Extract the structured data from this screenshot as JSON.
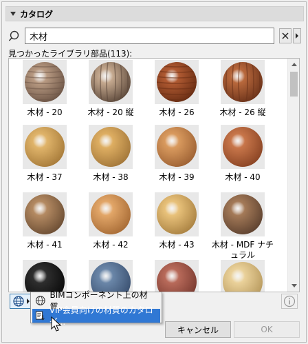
{
  "header": {
    "title": "カタログ"
  },
  "search": {
    "value": "木材"
  },
  "found_label": "見つかったライブラリ部品(113):",
  "items": [
    {
      "label": "木材 - 20",
      "base": "#b89a82",
      "dark": "#6e5647",
      "pattern": "stripes-h"
    },
    {
      "label": "木材 - 20 縦",
      "base": "#c4a88e",
      "dark": "#5e4a3c",
      "pattern": "stripes-v"
    },
    {
      "label": "木材 - 26",
      "base": "#b05a32",
      "dark": "#6a2e14",
      "pattern": "stripes-h"
    },
    {
      "label": "木材 - 26 縦",
      "base": "#b8683c",
      "dark": "#6c331a",
      "pattern": "stripes-v"
    },
    {
      "label": "木材 - 37",
      "base": "#e0b46a",
      "dark": "#a77b3a",
      "pattern": "plain"
    },
    {
      "label": "木材 - 38",
      "base": "#deae62",
      "dark": "#a3773a",
      "pattern": "plain"
    },
    {
      "label": "木材 - 39",
      "base": "#d99a5e",
      "dark": "#9e6234",
      "pattern": "plain"
    },
    {
      "label": "木材 - 40",
      "base": "#c8764a",
      "dark": "#8a4424",
      "pattern": "plain"
    },
    {
      "label": "木材 - 41",
      "base": "#b48a62",
      "dark": "#6c4e34",
      "pattern": "plain"
    },
    {
      "label": "木材 - 42",
      "base": "#e2a668",
      "dark": "#a86c36",
      "pattern": "plain"
    },
    {
      "label": "木材 - 43",
      "base": "#e8c17a",
      "dark": "#aa8242",
      "pattern": "plain"
    },
    {
      "label": "木材 - MDF ナチュラル",
      "base": "#a47a58",
      "dark": "#5e4230",
      "pattern": "plain"
    },
    {
      "label": "",
      "base": "#2e2e2e",
      "dark": "#0a0a0a",
      "pattern": "plain"
    },
    {
      "label": "",
      "base": "#6a86a8",
      "dark": "#3a5070",
      "pattern": "plain"
    },
    {
      "label": "",
      "base": "#b86a5a",
      "dark": "#7a3a30",
      "pattern": "plain"
    },
    {
      "label": "",
      "base": "#ead19a",
      "dark": "#b89a5e",
      "pattern": "plain"
    }
  ],
  "popup": {
    "item1": "BIMコンポーネント上の材質...",
    "item2": "VIP会員向けの材質のカタログ..."
  },
  "buttons": {
    "cancel": "キャンセル",
    "ok": "OK"
  },
  "colors": {
    "menu_highlight": "#3078d4",
    "accent": "#3c7fb1"
  }
}
